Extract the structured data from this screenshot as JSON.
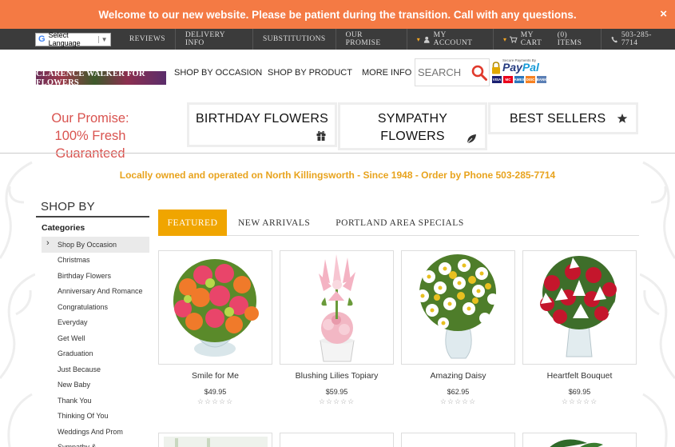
{
  "banner": {
    "text": "Welcome to our new website.  Please be patient during the transition. Call with any questions.",
    "close": "×"
  },
  "topnav": {
    "language": "Select Language",
    "items": [
      "REVIEWS",
      "DELIVERY INFO",
      "SUBSTITUTIONS",
      "OUR PROMISE"
    ],
    "account": "MY ACCOUNT",
    "cart": "MY CART",
    "cart_count": "(0) ITEMS",
    "phone": "503-285-7714"
  },
  "header": {
    "logo": "CLARENCE WALKER FOR FLOWERS",
    "nav": [
      "SHOP BY OCCASION",
      "SHOP BY PRODUCT",
      "MORE INFO"
    ],
    "search_placeholder": "SEARCH",
    "paypal": {
      "secure": "Secure Payments By",
      "brand_a": "Pay",
      "brand_b": "Pal",
      "cards": [
        "VISA",
        "MC",
        "AMEX",
        "DISC",
        "BANK"
      ]
    }
  },
  "promise": {
    "line1": "Our Promise:",
    "line2": "100% Fresh",
    "line3": "Guaranteed"
  },
  "category_boxes": [
    {
      "label": "BIRTHDAY FLOWERS",
      "icon": "gift-icon"
    },
    {
      "label": "SYMPATHY FLOWERS",
      "icon": "leaf-icon"
    },
    {
      "label": "BEST SELLERS",
      "icon": "star-icon"
    }
  ],
  "tagline": "Locally owned and operated on North Killingsworth  -  Since 1948 - Order by Phone 503-285-7714",
  "sidebar": {
    "title": "SHOP BY",
    "categories_label": "Categories",
    "items": [
      "Shop By Occasion",
      "Christmas",
      "Birthday Flowers",
      "Anniversary And Romance",
      "Congratulations",
      "Everyday",
      "Get Well",
      "Graduation",
      "Just Because",
      "New Baby",
      "Thank You",
      "Thinking Of You",
      "Weddings And Prom",
      "Sympathy &"
    ]
  },
  "tabs": [
    "FEATURED",
    "NEW ARRIVALS",
    "PORTLAND AREA SPECIALS"
  ],
  "products": [
    {
      "name": "Smile for Me",
      "price": "$49.95",
      "stars": "☆☆☆☆☆"
    },
    {
      "name": "Blushing Lilies Topiary",
      "price": "$59.95",
      "stars": "☆☆☆☆☆"
    },
    {
      "name": "Amazing Daisy",
      "price": "$62.95",
      "stars": "☆☆☆☆☆"
    },
    {
      "name": "Heartfelt Bouquet",
      "price": "$69.95",
      "stars": "☆☆☆☆☆"
    }
  ],
  "colors": {
    "banner": "#f47a44",
    "topnav": "#3b3b3b",
    "accent": "#f0a500",
    "promise": "#d9534f",
    "tagline": "#e8a31d"
  }
}
